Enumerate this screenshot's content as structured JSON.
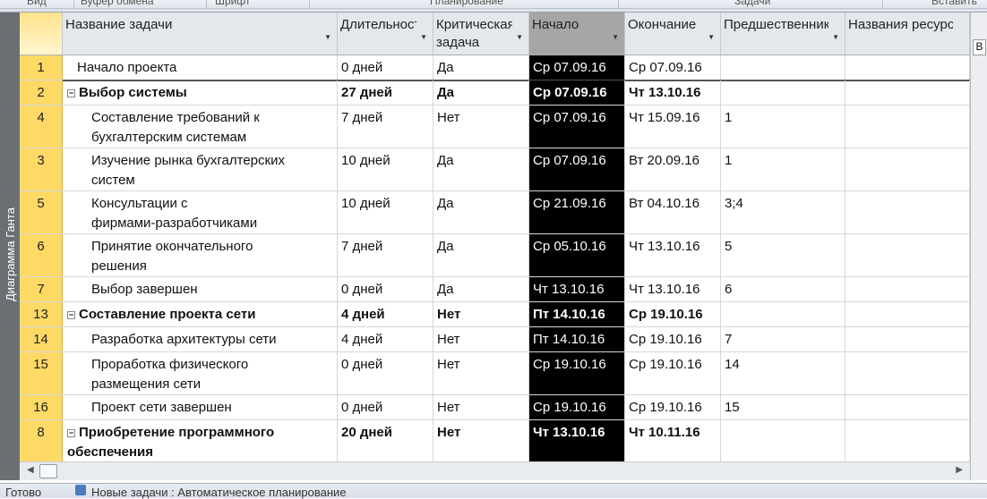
{
  "ribbon": {
    "groups": [
      "Вид",
      "Буфер обмена",
      "Шрифт",
      "Планирование",
      "Задачи",
      "Вставить"
    ]
  },
  "view_label": "Диаграмма Ганта",
  "columns": [
    "Название задачи",
    "Длительност",
    "Критическая задача",
    "Начало",
    "Окончание",
    "Предшественник",
    "Названия ресурсов"
  ],
  "right_tab": "В",
  "rows": [
    {
      "id": "1",
      "name": "Начало проекта",
      "level": 0,
      "summary": false,
      "dur": "0 дней",
      "crit": "Да",
      "start": "Ср 07.09.16",
      "end": "Ср 07.09.16",
      "pred": "",
      "lines": 1
    },
    {
      "id": "2",
      "name": "Выбор системы",
      "level": 0,
      "summary": true,
      "dur": "27 дней",
      "crit": "Да",
      "start": "Ср 07.09.16",
      "end": "Чт 13.10.16",
      "pred": "",
      "lines": 1
    },
    {
      "id": "4",
      "name": "Составление требований к|бухгалтерским системам",
      "level": 1,
      "summary": false,
      "dur": "7 дней",
      "crit": "Нет",
      "start": "Ср 07.09.16",
      "end": "Чт 15.09.16",
      "pred": "1",
      "lines": 2
    },
    {
      "id": "3",
      "name": "Изучение рынка бухгалтерских|систем",
      "level": 1,
      "summary": false,
      "dur": "10 дней",
      "crit": "Да",
      "start": "Ср 07.09.16",
      "end": "Вт 20.09.16",
      "pred": "1",
      "lines": 2
    },
    {
      "id": "5",
      "name": "Консультации с|фирмами-разработчиками",
      "level": 1,
      "summary": false,
      "dur": "10 дней",
      "crit": "Да",
      "start": "Ср 21.09.16",
      "end": "Вт 04.10.16",
      "pred": "3;4",
      "lines": 2
    },
    {
      "id": "6",
      "name": "Принятие окончательного|решения",
      "level": 1,
      "summary": false,
      "dur": "7 дней",
      "crit": "Да",
      "start": "Ср 05.10.16",
      "end": "Чт 13.10.16",
      "pred": "5",
      "lines": 2
    },
    {
      "id": "7",
      "name": "Выбор завершен",
      "level": 1,
      "summary": false,
      "dur": "0 дней",
      "crit": "Да",
      "start": "Чт 13.10.16",
      "end": "Чт 13.10.16",
      "pred": "6",
      "lines": 1
    },
    {
      "id": "13",
      "name": "Составление проекта сети",
      "level": 0,
      "summary": true,
      "dur": "4 дней",
      "crit": "Нет",
      "start": "Пт 14.10.16",
      "end": "Ср 19.10.16",
      "pred": "",
      "lines": 1
    },
    {
      "id": "14",
      "name": "Разработка архитектуры сети",
      "level": 1,
      "summary": false,
      "dur": "4 дней",
      "crit": "Нет",
      "start": "Пт 14.10.16",
      "end": "Ср 19.10.16",
      "pred": "7",
      "lines": 1
    },
    {
      "id": "15",
      "name": "Проработка физического|размещения сети",
      "level": 1,
      "summary": false,
      "dur": "0 дней",
      "crit": "Нет",
      "start": "Ср 19.10.16",
      "end": "Ср 19.10.16",
      "pred": "14",
      "lines": 2
    },
    {
      "id": "16",
      "name": "Проект сети завершен",
      "level": 1,
      "summary": false,
      "dur": "0 дней",
      "crit": "Нет",
      "start": "Ср 19.10.16",
      "end": "Ср 19.10.16",
      "pred": "15",
      "lines": 1
    },
    {
      "id": "8",
      "name": "Приобретение программного|обеспечения",
      "level": 0,
      "summary": true,
      "dur": "20 дней",
      "crit": "Нет",
      "start": "Чт 13.10.16",
      "end": "Чт 10.11.16",
      "pred": "",
      "lines": 2
    }
  ],
  "status": {
    "ready": "Готово",
    "mode": "Новые задачи : Автоматическое планирование"
  }
}
